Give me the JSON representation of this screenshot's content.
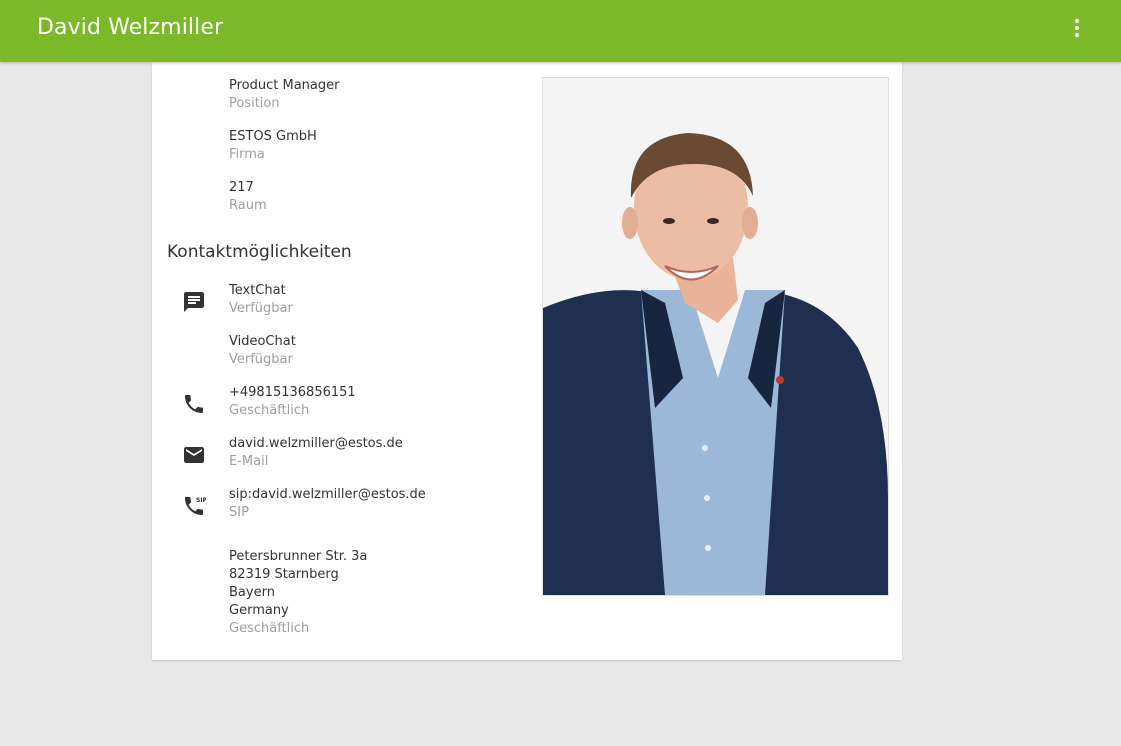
{
  "header": {
    "title": "David Welzmiller",
    "menu_icon": "more-vert-icon",
    "color": "#7cb929"
  },
  "details": [
    {
      "value": "Product Manager",
      "label": "Position"
    },
    {
      "value": "ESTOS GmbH",
      "label": "Firma"
    },
    {
      "value": "217",
      "label": "Raum"
    }
  ],
  "contact": {
    "section_title": "Kontaktmöglichkeiten",
    "items": [
      {
        "value": "TextChat",
        "label": "Verfügbar",
        "icon": "chat-icon"
      },
      {
        "value": "VideoChat",
        "label": "Verfügbar",
        "icon": ""
      },
      {
        "value": "+49815136856151",
        "label": "Geschäftlich",
        "icon": "phone-icon"
      },
      {
        "value": "david.welzmiller@estos.de",
        "label": "E-Mail",
        "icon": "email-icon"
      },
      {
        "value": "sip:david.welzmiller@estos.de",
        "label": "SIP",
        "icon": "sip-phone-icon"
      }
    ],
    "address": {
      "lines": [
        "Petersbrunner Str. 3a",
        "82319 Starnberg",
        "Bayern",
        "Germany"
      ],
      "label": "Geschäftlich"
    }
  },
  "photo": {
    "icon": "contact-photo"
  }
}
